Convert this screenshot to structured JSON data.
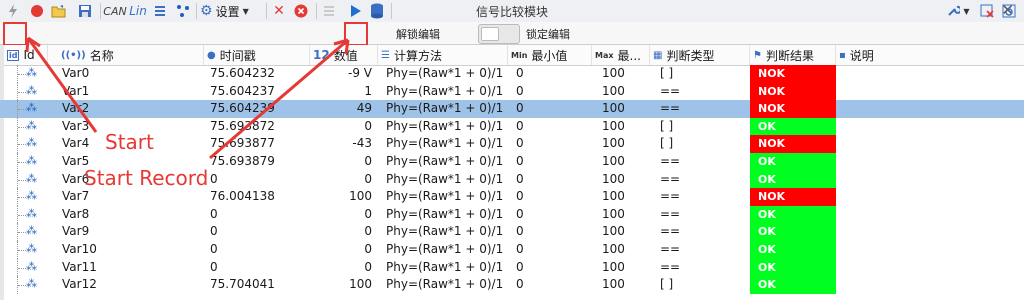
{
  "window": {
    "title": "信号比较模块",
    "close_glyph": "✕"
  },
  "toolbar": {
    "settings_label": "设置",
    "unlock_edit_label": "解锁编辑",
    "lock_edit_label": "锁定编辑",
    "can_label": "CAN",
    "lin_label": "Lin"
  },
  "columns": [
    {
      "label": "Id",
      "icon": "id-icon"
    },
    {
      "label": "名称",
      "icon": "signal-icon"
    },
    {
      "label": "时间戳",
      "icon": "clock-icon"
    },
    {
      "label": "数值",
      "icon": "number-icon",
      "icon_text": "12"
    },
    {
      "label": "计算方法",
      "icon": "formula-icon"
    },
    {
      "label": "最小值",
      "icon": "min-icon",
      "icon_text": "Min"
    },
    {
      "label": "最...",
      "icon": "max-icon",
      "icon_text": "Max"
    },
    {
      "label": "判断类型",
      "icon": "judge-type-icon"
    },
    {
      "label": "判断结果",
      "icon": "judge-result-icon"
    },
    {
      "label": "说明",
      "icon": "comment-icon"
    }
  ],
  "rows": [
    {
      "name": "Var0",
      "timestamp": "75.604232",
      "value": "-9 V",
      "formula": "Phy=(Raw*1 + 0)/1",
      "min": "0",
      "max": "100",
      "type": "[ ]",
      "result": "NOK"
    },
    {
      "name": "Var1",
      "timestamp": "75.604237",
      "value": "1",
      "formula": "Phy=(Raw*1 + 0)/1",
      "min": "0",
      "max": "100",
      "type": "==",
      "result": "NOK"
    },
    {
      "name": "Var2",
      "timestamp": "75.604239",
      "value": "49",
      "formula": "Phy=(Raw*1 + 0)/1",
      "min": "0",
      "max": "100",
      "type": "==",
      "result": "NOK"
    },
    {
      "name": "Var3",
      "timestamp": "75.693872",
      "value": "0",
      "formula": "Phy=(Raw*1 + 0)/1",
      "min": "0",
      "max": "100",
      "type": "[ ]",
      "result": "OK"
    },
    {
      "name": "Var4",
      "timestamp": "75.693877",
      "value": "-43",
      "formula": "Phy=(Raw*1 + 0)/1",
      "min": "0",
      "max": "100",
      "type": "[ ]",
      "result": "NOK"
    },
    {
      "name": "Var5",
      "timestamp": "75.693879",
      "value": "0",
      "formula": "Phy=(Raw*1 + 0)/1",
      "min": "0",
      "max": "100",
      "type": "==",
      "result": "OK"
    },
    {
      "name": "Var6",
      "timestamp": "0",
      "value": "0",
      "formula": "Phy=(Raw*1 + 0)/1",
      "min": "0",
      "max": "100",
      "type": "==",
      "result": "OK"
    },
    {
      "name": "Var7",
      "timestamp": "76.004138",
      "value": "100",
      "formula": "Phy=(Raw*1 + 0)/1",
      "min": "0",
      "max": "100",
      "type": "==",
      "result": "NOK"
    },
    {
      "name": "Var8",
      "timestamp": "0",
      "value": "0",
      "formula": "Phy=(Raw*1 + 0)/1",
      "min": "0",
      "max": "100",
      "type": "==",
      "result": "OK"
    },
    {
      "name": "Var9",
      "timestamp": "0",
      "value": "0",
      "formula": "Phy=(Raw*1 + 0)/1",
      "min": "0",
      "max": "100",
      "type": "==",
      "result": "OK"
    },
    {
      "name": "Var10",
      "timestamp": "0",
      "value": "0",
      "formula": "Phy=(Raw*1 + 0)/1",
      "min": "0",
      "max": "100",
      "type": "==",
      "result": "OK"
    },
    {
      "name": "Var11",
      "timestamp": "0",
      "value": "0",
      "formula": "Phy=(Raw*1 + 0)/1",
      "min": "0",
      "max": "100",
      "type": "==",
      "result": "OK"
    },
    {
      "name": "Var12",
      "timestamp": "75.704041",
      "value": "100",
      "formula": "Phy=(Raw*1 + 0)/1",
      "min": "0",
      "max": "100",
      "type": "[ ]",
      "result": "OK"
    }
  ],
  "selected_row": "Var2",
  "annotations": {
    "start": "Start",
    "start_record": "Start Record"
  },
  "colors": {
    "nok": "#ff0000",
    "ok": "#00ff21",
    "selection": "#9fc3e8",
    "annotation": "#e53935"
  }
}
